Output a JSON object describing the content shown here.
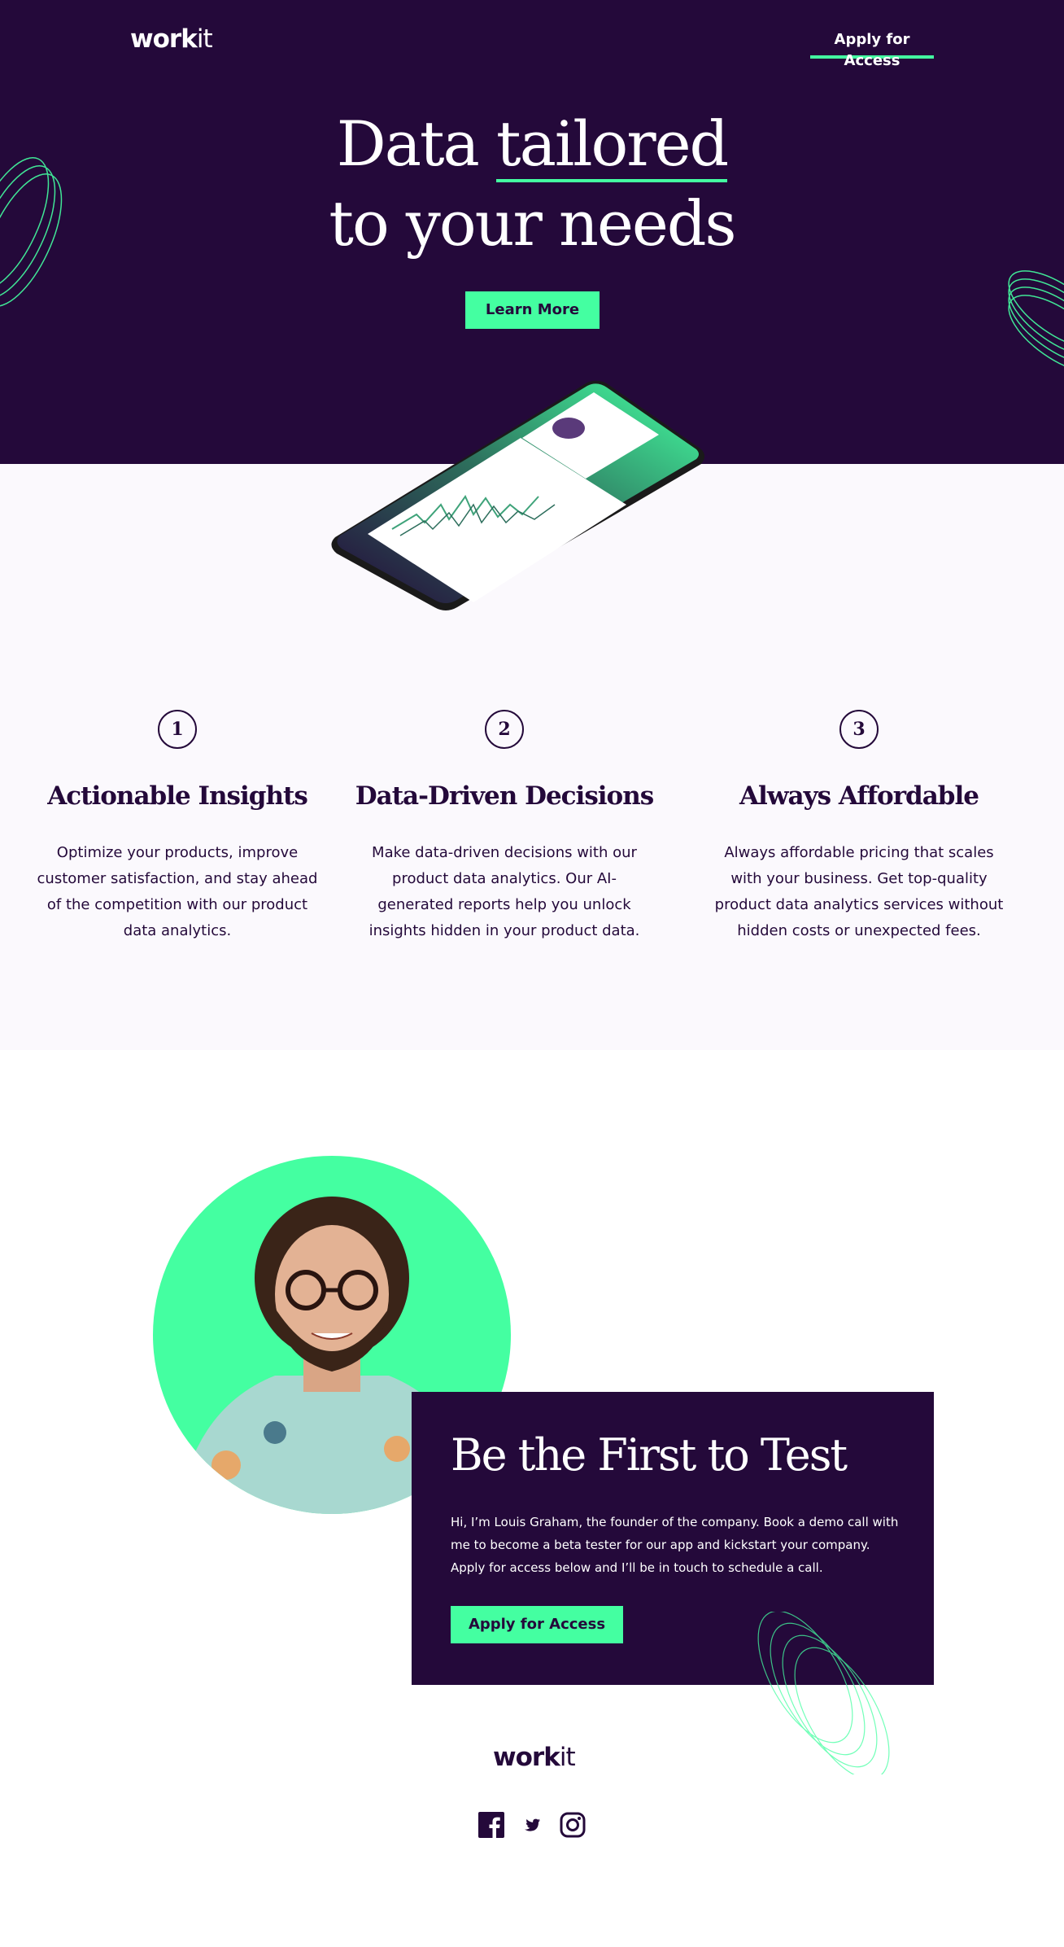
{
  "brand": {
    "logo_bold": "work",
    "logo_light": "it"
  },
  "header": {
    "apply_link": "Apply for Access"
  },
  "hero": {
    "title_part1": "Data ",
    "title_underlined": "tailored",
    "title_line2": "to your needs",
    "cta": "Learn More"
  },
  "features": [
    {
      "number": "1",
      "title": "Actionable Insights",
      "text": "Optimize your products, improve customer satisfaction, and stay ahead of the competition with our product data analytics."
    },
    {
      "number": "2",
      "title": "Data-Driven Decisions",
      "text": "Make data-driven decisions with our product data analytics. Our AI-generated reports help you unlock insights hidden in your product data."
    },
    {
      "number": "3",
      "title": "Always Affordable",
      "text": "Always affordable pricing that scales with your business. Get top-quality product data analytics services without hidden costs or unexpected fees."
    }
  ],
  "cta_card": {
    "title": "Be the First to Test",
    "text": "Hi, I’m Louis Graham, the founder of the company. Book a demo call with me to become a beta tester for our app and kickstart your company. Apply for access below and I’ll be in touch to schedule a call.",
    "button": "Apply for Access"
  },
  "social": {
    "icons": [
      "facebook-icon",
      "twitter-icon",
      "instagram-icon"
    ]
  },
  "colors": {
    "dark_purple": "#24093a",
    "mint": "#44ffa1",
    "light_bg": "#fbf9fd"
  }
}
